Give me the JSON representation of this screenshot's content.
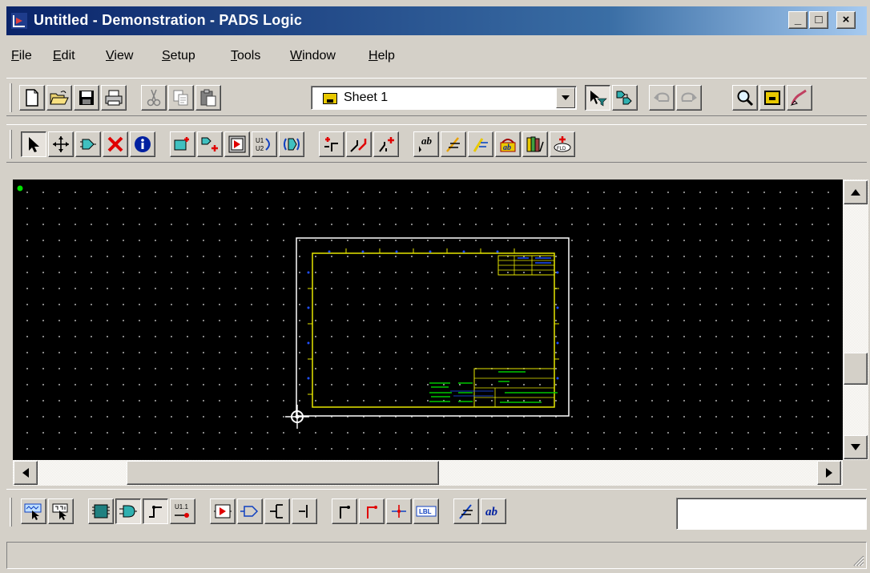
{
  "window": {
    "title": "Untitled - Demonstration - PADS Logic",
    "minimize_label": "_",
    "maximize_label": "□",
    "close_label": "×"
  },
  "menu": {
    "items": [
      {
        "label": "File",
        "accel": "F",
        "rest": "ile"
      },
      {
        "label": "Edit",
        "accel": "E",
        "rest": "dit"
      },
      {
        "label": "View",
        "accel": "V",
        "rest": "iew"
      },
      {
        "label": "Setup",
        "accel": "S",
        "rest": "etup"
      },
      {
        "label": "Tools",
        "accel": "T",
        "rest": "ools"
      },
      {
        "label": "Window",
        "accel": "W",
        "rest": "indow"
      },
      {
        "label": "Help",
        "accel": "H",
        "rest": "elp"
      }
    ]
  },
  "standard_toolbar": {
    "sheet_selector": {
      "value": "Sheet 1"
    },
    "buttons": [
      "new-icon",
      "open-icon",
      "save-icon",
      "print-icon",
      "cut-icon",
      "copy-icon",
      "paste-icon",
      "select-filter-icon",
      "design-toolbar-icon",
      "undo-icon",
      "redo-icon",
      "zoom-icon",
      "sheet-properties-icon",
      "redraw-icon"
    ]
  },
  "design_toolbar": {
    "buttons": [
      "select-icon",
      "move-icon",
      "add-part-icon",
      "delete-icon",
      "query-icon",
      "add-component-icon",
      "add-part-type-icon",
      "add-sheet-icon",
      "swap-gates-icon",
      "swap-pins-icon",
      "add-connection-icon",
      "add-bus-icon",
      "add-net-label-icon",
      "add-text-icon",
      "add-2d-line-icon",
      "add-field-icon",
      "text-icon",
      "library-icon",
      "field-icon"
    ]
  },
  "bottom_toolbar": {
    "u11_label": "U1.1",
    "lbl_label": "LBL",
    "ab_label": "ab",
    "command_input": {
      "value": "",
      "placeholder": ""
    }
  },
  "status": {
    "text": ""
  },
  "colors": {
    "titlebar_start": "#0a246a",
    "titlebar_end": "#a6caf0",
    "canvas": "#000000",
    "grid_dot": "#9a9a9a",
    "border_yellow": "#e6e600",
    "sheet_white": "#ffffff",
    "net_green": "#00c800",
    "pin_blue": "#2050ff"
  }
}
